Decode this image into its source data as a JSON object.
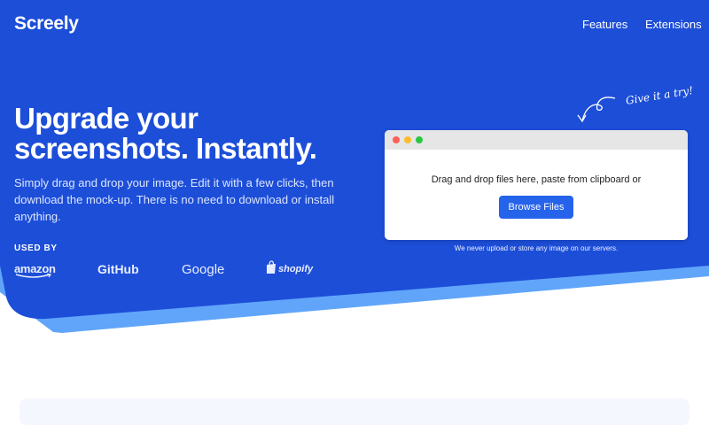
{
  "colors": {
    "hero_blue": "#1d4ed8",
    "accent_light_blue": "#60a5fa",
    "button_blue": "#2563eb"
  },
  "nav": {
    "brand": "Screely",
    "links": [
      "Features",
      "Extensions"
    ]
  },
  "hero": {
    "headline": "Upgrade your screenshots. Instantly.",
    "subtext": "Simply drag and drop your image. Edit it with a few clicks, then download the mock-up. There is no need to download or install anything.",
    "used_by_label": "USED BY",
    "logos": [
      "amazon",
      "GitHub",
      "Google",
      "shopify"
    ],
    "try_hint": "Give it a try!"
  },
  "upload": {
    "drop_text": "Drag and drop files here, paste from clipboard or",
    "browse_label": "Browse Files",
    "privacy_note": "We never upload or store any image on our servers."
  },
  "icons": [
    "window-close-dot-icon",
    "window-minimize-dot-icon",
    "window-maximize-dot-icon",
    "curved-arrow-icon",
    "shopping-bag-icon"
  ]
}
